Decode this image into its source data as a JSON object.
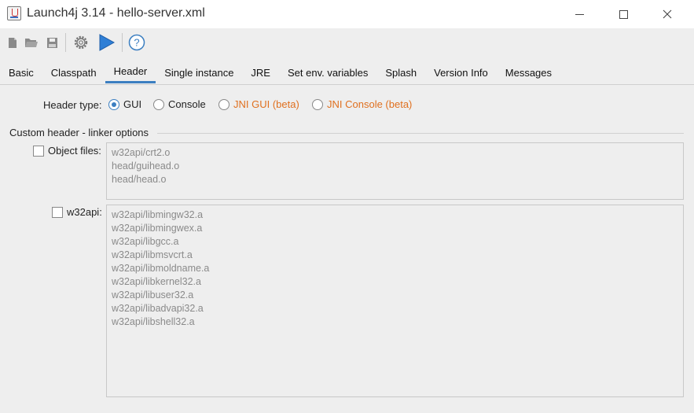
{
  "window": {
    "title": "Launch4j 3.14 - hello-server.xml"
  },
  "toolbar": {
    "buttons": [
      "new-icon",
      "open-icon",
      "save-icon",
      "settings-icon",
      "run-icon",
      "help-icon"
    ]
  },
  "tabs": [
    {
      "label": "Basic"
    },
    {
      "label": "Classpath"
    },
    {
      "label": "Header"
    },
    {
      "label": "Single instance"
    },
    {
      "label": "JRE"
    },
    {
      "label": "Set env. variables"
    },
    {
      "label": "Splash"
    },
    {
      "label": "Version Info"
    },
    {
      "label": "Messages"
    }
  ],
  "active_tab": "Header",
  "header_type": {
    "label": "Header type:",
    "options": [
      {
        "label": "GUI",
        "checked": true
      },
      {
        "label": "Console",
        "checked": false
      },
      {
        "label": "JNI GUI (beta)",
        "checked": false
      },
      {
        "label": "JNI Console (beta)",
        "checked": false
      }
    ]
  },
  "linker": {
    "group_title": "Custom header - linker options",
    "object_files": {
      "label": "Object files:",
      "checked": false,
      "lines": [
        "w32api/crt2.o",
        "head/guihead.o",
        "head/head.o"
      ]
    },
    "w32api": {
      "label": "w32api:",
      "checked": false,
      "lines": [
        "w32api/libmingw32.a",
        "w32api/libmingwex.a",
        "w32api/libgcc.a",
        "w32api/libmsvcrt.a",
        "w32api/libmoldname.a",
        "w32api/libkernel32.a",
        "w32api/libuser32.a",
        "w32api/libadvapi32.a",
        "w32api/libshell32.a"
      ]
    }
  },
  "colors": {
    "accent": "#3c7fc1",
    "beta_option": "#e0701f"
  }
}
